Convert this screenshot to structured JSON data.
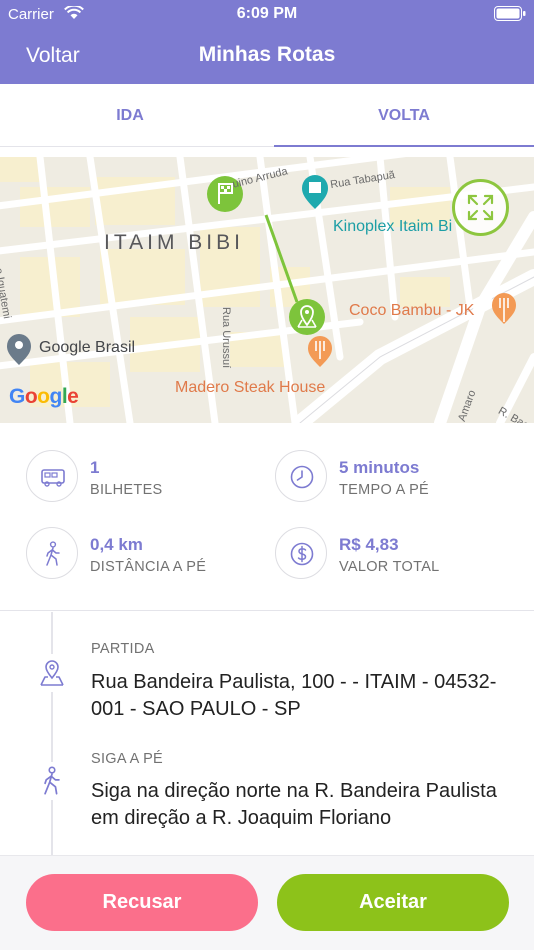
{
  "status_bar": {
    "carrier": "Carrier",
    "time": "6:09 PM"
  },
  "nav": {
    "back_label": "Voltar",
    "title": "Minhas Rotas"
  },
  "tabs": [
    {
      "label": "IDA",
      "selected": false
    },
    {
      "label": "VOLTA",
      "selected": true
    }
  ],
  "map": {
    "district": "ITAIM BIBI",
    "places": {
      "kinoplex": "Kinoplex Itaim Bi",
      "coco_bambu": "Coco Bambu - JK",
      "google_brasil": "Google Brasil",
      "madero": "Madero Steak House"
    },
    "streets": {
      "joaquim": "uino Arruda",
      "tabapua": "Rua Tabapuã",
      "urussui": "Rua Urussuí",
      "iguatemi": "o Iguatemi",
      "amaro": "Amaro",
      "rbae": "R. Bae"
    },
    "logo": {
      "g1": "G",
      "o1": "o",
      "o2": "o",
      "g2": "g",
      "l": "l",
      "e": "e"
    },
    "colors": {
      "route": "#7dc43b",
      "marker": "#7dc43b",
      "expand": "#8dc63f"
    }
  },
  "summary": {
    "bilhetes": {
      "value": "1",
      "label": "BILHETES",
      "icon": "bus-icon"
    },
    "tempo": {
      "value": "5 minutos",
      "label": "TEMPO A PÉ",
      "icon": "clock-icon"
    },
    "distancia": {
      "value": "0,4 km",
      "label": "DISTÂNCIA A PÉ",
      "icon": "walking-icon"
    },
    "valor": {
      "value": "R$ 4,83",
      "label": "VALOR TOTAL",
      "icon": "dollar-icon"
    }
  },
  "steps": [
    {
      "title": "PARTIDA",
      "text": "Rua Bandeira Paulista, 100 -  - ITAIM - 04532-001 - SAO PAULO - SP",
      "icon": "map-pin-icon"
    },
    {
      "title": "SIGA A PÉ",
      "text": "Siga na direção norte na R. Bandeira Paulista em direção a R. Joaquim Floriano",
      "icon": "walking-icon"
    }
  ],
  "actions": {
    "reject_label": "Recusar",
    "accept_label": "Aceitar"
  },
  "theme": {
    "primary": "#7d7bd1",
    "reject": "#fb6f8b",
    "accept": "#8dc21a"
  }
}
